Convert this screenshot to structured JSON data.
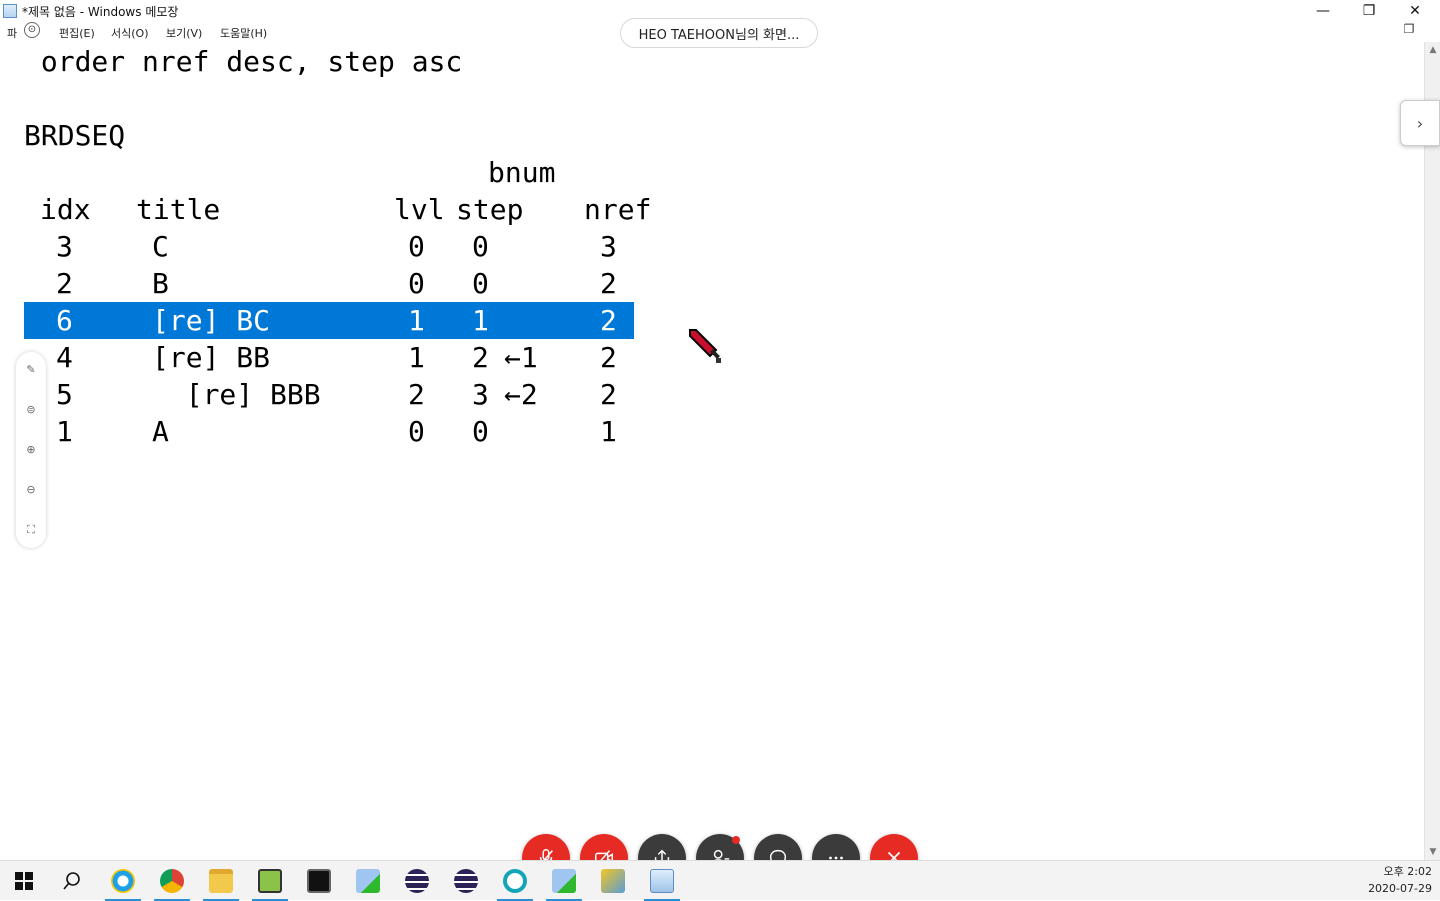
{
  "window": {
    "title": "*제목 없음 - Windows 메모장",
    "minimize_glyph": "—",
    "maximize_glyph": "❐",
    "close_glyph": "✕"
  },
  "menu": {
    "file_partial": "파",
    "indicator_glyph": "⊙",
    "items": [
      "편집(E)",
      "서식(O)",
      "보기(V)",
      "도움말(H)"
    ]
  },
  "share_banner": "HEO TAEHOON님의 화면...",
  "editor": {
    "line1": " order nref desc, step asc",
    "table_name": "BRDSEQ",
    "header_above": "bnum",
    "headers": {
      "idx": "idx",
      "title": "title",
      "lvl": "lvl",
      "step": "step",
      "nref": "nref"
    },
    "rows": [
      {
        "idx": "3",
        "title": "C",
        "lvl": "0",
        "step": "0",
        "note": "",
        "nref": "3",
        "selected": false
      },
      {
        "idx": "2",
        "title": "B",
        "lvl": "0",
        "step": "0",
        "note": "",
        "nref": "2",
        "selected": false
      },
      {
        "idx": "6",
        "title": "[re] BC",
        "lvl": "1",
        "step": "1",
        "note": "",
        "nref": "2",
        "selected": true
      },
      {
        "idx": "4",
        "title": "[re] BB",
        "lvl": "1",
        "step": "2",
        "note": "←1",
        "nref": "2",
        "selected": false
      },
      {
        "idx": "5",
        "title": "  [re] BBB",
        "lvl": "2",
        "step": "3",
        "note": "←2",
        "nref": "2",
        "selected": false
      },
      {
        "idx": "1",
        "title": "A",
        "lvl": "0",
        "step": "0",
        "note": "",
        "nref": "1",
        "selected": false
      }
    ],
    "selection_color": "#0078d7"
  },
  "clock": {
    "time": "오후 2:02",
    "date": "2020-07-29"
  },
  "meeting_controls": [
    "mute-mic",
    "stop-video",
    "share-screen",
    "participants",
    "chat",
    "more",
    "leave"
  ],
  "colors": {
    "meeting_red": "#e52b23",
    "meeting_dark": "#3b3b3b",
    "taskbar_accent": "#2a8fd6"
  }
}
